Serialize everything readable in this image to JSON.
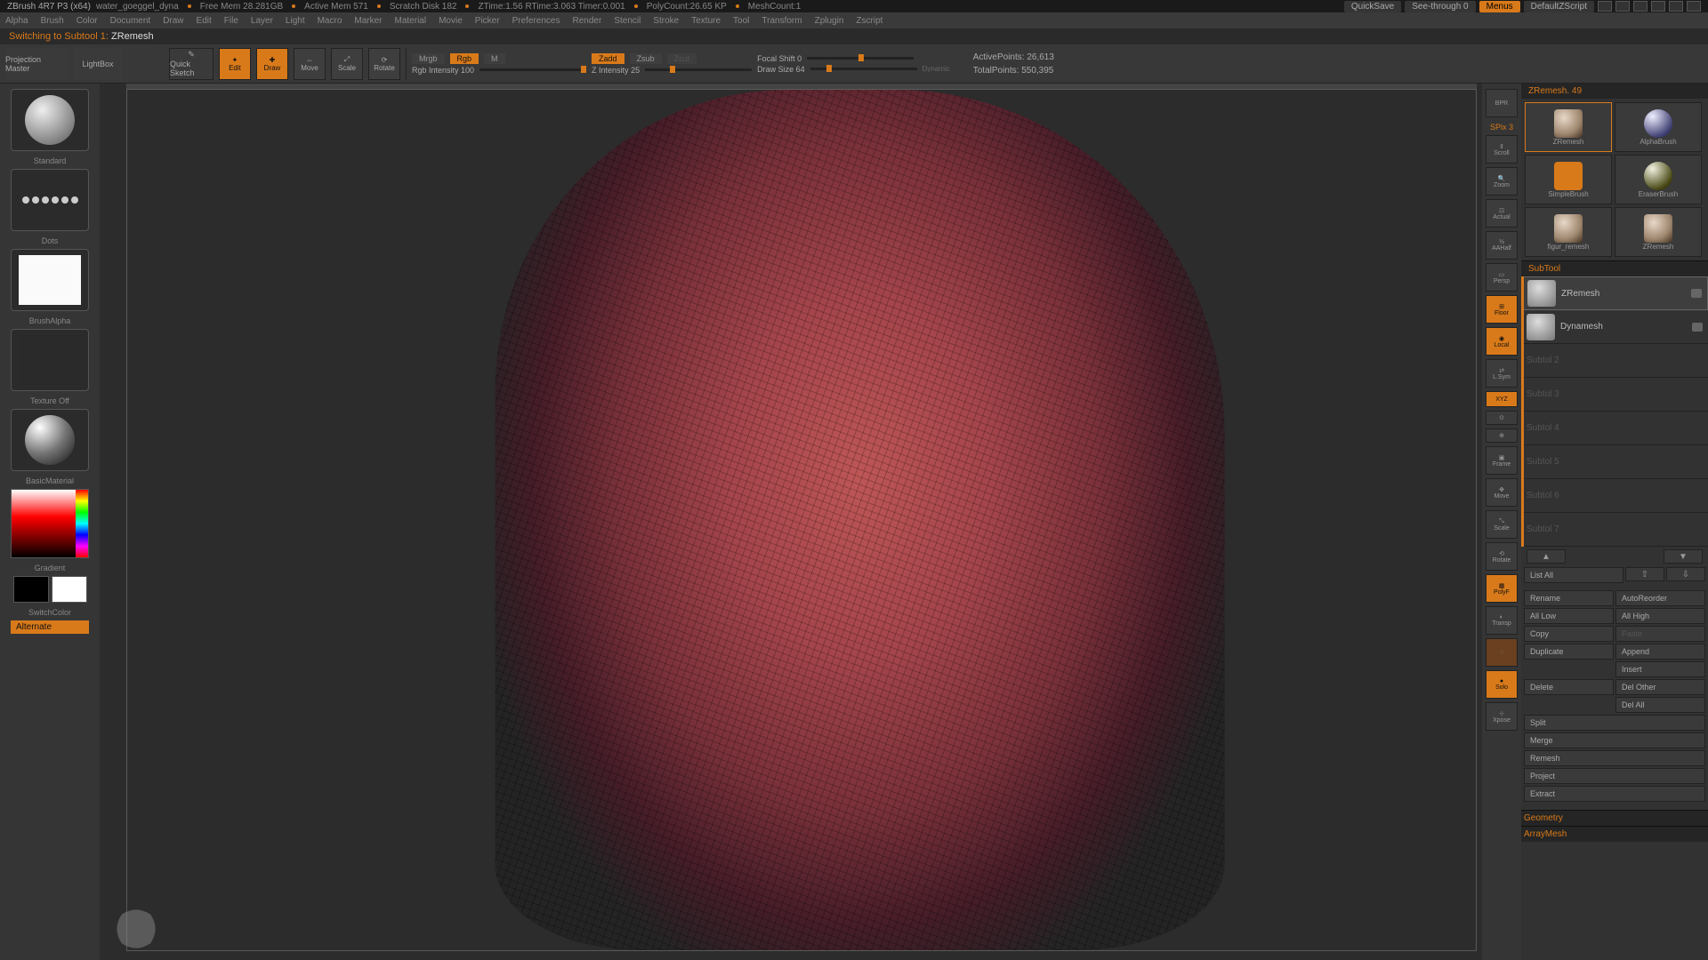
{
  "status": {
    "app": "ZBrush 4R7 P3 (x64)",
    "file": "water_goeggel_dyna",
    "freeMem": "Free Mem 28.281GB",
    "activeMem": "Active Mem 571",
    "scratch": "Scratch Disk 182",
    "ztime": "ZTime:1.56 RTime:3.063 Timer:0.001",
    "polycount": "PolyCount:26.65 KP",
    "meshcount": "MeshCount:1",
    "quicksave": "QuickSave",
    "seethrough": "See-through  0",
    "menus": "Menus",
    "defaultscript": "DefaultZScript"
  },
  "menu": [
    "Alpha",
    "Brush",
    "Color",
    "Document",
    "Draw",
    "Edit",
    "File",
    "Layer",
    "Light",
    "Macro",
    "Marker",
    "Material",
    "Movie",
    "Picker",
    "Preferences",
    "Render",
    "Stencil",
    "Stroke",
    "Texture",
    "Tool",
    "Transform",
    "Zplugin",
    "Zscript"
  ],
  "message": {
    "text": "Switching to Subtool 1:",
    "arg": "ZRemesh"
  },
  "shelf": {
    "projection": "Projection Master",
    "lightbox": "LightBox",
    "quicksketch": "Quick Sketch",
    "edit": "Edit",
    "draw": "Draw",
    "move": "Move",
    "scale": "Scale",
    "rotate": "Rotate",
    "mrgb": "Mrgb",
    "rgb": "Rgb",
    "m": "M",
    "zadd": "Zadd",
    "zsub": "Zsub",
    "zcut": "Zcut",
    "rgbIntensity": "Rgb Intensity 100",
    "zIntensity": "Z Intensity 25",
    "focalShift": "Focal Shift 0",
    "drawSize": "Draw Size 64",
    "dynamic": "Dynamic",
    "activePoints": "ActivePoints: 26,613",
    "totalPoints": "TotalPoints: 550,395"
  },
  "left": {
    "brush": "Standard",
    "stroke": "Dots",
    "alpha": "BrushAlpha",
    "texture": "Texture Off",
    "material": "BasicMaterial",
    "gradient": "Gradient",
    "switchcolor": "SwitchColor",
    "alternate": "Alternate"
  },
  "rightTools": {
    "spix": "SPix 3",
    "items": [
      "BPR",
      "Scroll",
      "Zoom",
      "Actual",
      "AAHalf",
      "Dynamic Persp",
      "Floor",
      "Local",
      "L.Sym",
      "XYZ",
      "Y",
      "Z",
      "Frame",
      "Move",
      "Scale",
      "Rotate",
      "Line Fil PolyF",
      "Transp",
      "Ghost",
      "Solo",
      "Xpose"
    ]
  },
  "toolPanel": {
    "title": "ZRemesh. 49",
    "thumbs": [
      "ZRemesh",
      "AlphaBrush",
      "SimpleBrush",
      "EraserBrush",
      "figur_remesh",
      "ZRemesh"
    ],
    "section": "SubTool",
    "subtools": [
      {
        "name": "ZRemesh",
        "active": true
      },
      {
        "name": "Dynamesh",
        "active": false
      },
      {
        "name": "Subtol 2",
        "dim": true
      },
      {
        "name": "Subtol 3",
        "dim": true
      },
      {
        "name": "Subtol 4",
        "dim": true
      },
      {
        "name": "Subtol 5",
        "dim": true
      },
      {
        "name": "Subtol 6",
        "dim": true
      },
      {
        "name": "Subtol 7",
        "dim": true
      }
    ],
    "listAll": "List All",
    "rename": "Rename",
    "autoReorder": "AutoReorder",
    "allLow": "All Low",
    "allHigh": "All High",
    "copy": "Copy",
    "paste": "Paste",
    "duplicate": "Duplicate",
    "append": "Append",
    "insert": "Insert",
    "delete": "Delete",
    "delOther": "Del Other",
    "delAll": "Del All",
    "split": "Split",
    "merge": "Merge",
    "remesh": "Remesh",
    "project": "Project",
    "extract": "Extract",
    "geometry": "Geometry",
    "arraymesh": "ArrayMesh"
  }
}
